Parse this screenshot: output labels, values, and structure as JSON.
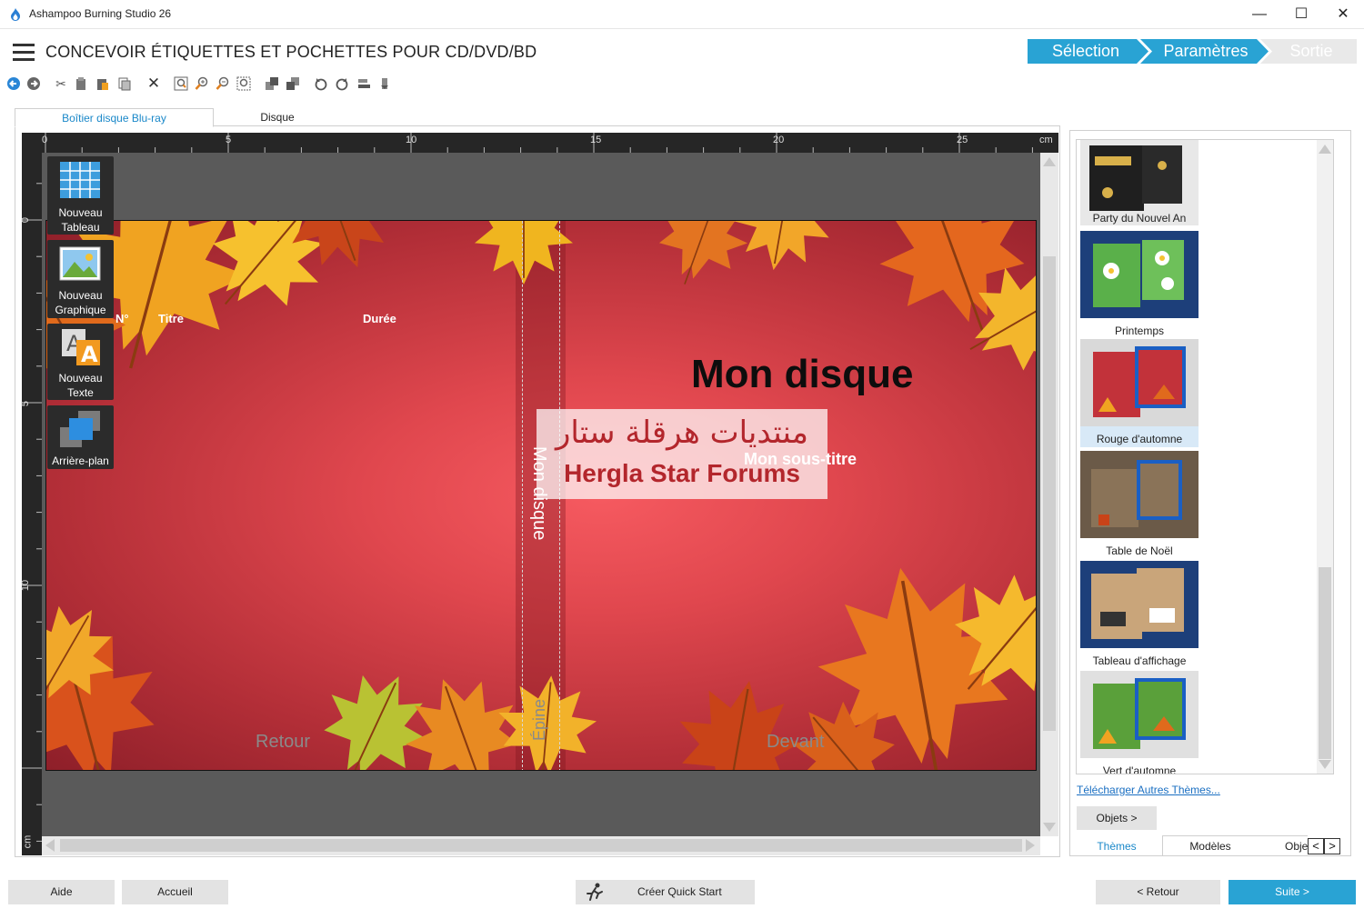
{
  "window": {
    "title": "Ashampoo Burning Studio 26",
    "minimize": "—",
    "maximize": "☐",
    "close": "✕"
  },
  "header": {
    "title": "CONCEVOIR ÉTIQUETTES ET POCHETTES POUR CD/DVD/BD",
    "steps": [
      {
        "label": "Sélection",
        "state": "active"
      },
      {
        "label": "Paramètres",
        "state": "active"
      },
      {
        "label": "Sortie",
        "state": "inactive"
      }
    ]
  },
  "toolbar": {
    "icons": [
      "back-icon",
      "forward-icon",
      "cut-icon",
      "copy-icon",
      "paste-icon",
      "duplicate-icon",
      "delete-icon",
      "zoom-fit-icon",
      "zoom-in-icon",
      "zoom-out-icon",
      "zoom-page-icon",
      "bring-front-icon",
      "send-back-icon",
      "rotate-left-icon",
      "rotate-right-icon",
      "align-left-icon",
      "align-right-icon"
    ]
  },
  "tabs": {
    "bluray": "Boîtier disque Blu-ray",
    "disc": "Disque"
  },
  "ruler": {
    "top_ticks": [
      "0",
      "5",
      "10",
      "15",
      "20",
      "25"
    ],
    "left_ticks": [
      "0",
      "5",
      "10"
    ],
    "unit": "cm"
  },
  "palette": [
    {
      "label1": "Nouveau",
      "label2": "Tableau",
      "icon": "table-icon"
    },
    {
      "label1": "Nouveau",
      "label2": "Graphique",
      "icon": "image-icon"
    },
    {
      "label1": "Nouveau",
      "label2": "Texte",
      "icon": "text-icon"
    },
    {
      "label1": "Arrière-plan",
      "label2": "",
      "icon": "background-icon"
    }
  ],
  "cover": {
    "title": "Mon disque",
    "subtitle": "Mon sous-titre",
    "spine_text": "Mon disque",
    "spine_label": "Épine",
    "back_label": "Retour",
    "front_label": "Devant",
    "columns": {
      "num": "N°",
      "title": "Titre",
      "duration": "Durée"
    }
  },
  "watermark": {
    "arabic": "منتديات هرقلة ستار",
    "latin": "Hergla Star Forums"
  },
  "themes": [
    {
      "name": "Party du Nouvel An",
      "selected": false
    },
    {
      "name": "Printemps",
      "selected": false
    },
    {
      "name": "Rouge d'automne",
      "selected": true
    },
    {
      "name": "Table de Noël",
      "selected": false
    },
    {
      "name": "Tableau d'affichage",
      "selected": false
    },
    {
      "name": "Vert d'automne",
      "selected": false
    }
  ],
  "right_panel": {
    "download_link": "Télécharger Autres Thèmes...",
    "objects_button": "Objets >",
    "tabs": {
      "themes": "Thèmes",
      "models": "Modèles",
      "objects": "Objets"
    },
    "prev": "<",
    "next": ">"
  },
  "footer": {
    "help": "Aide",
    "home": "Accueil",
    "quickstart": "Créer Quick Start",
    "back": "< Retour",
    "next": "Suite >"
  },
  "colors": {
    "accent": "#29a3d4",
    "cover_red": "#e0474e",
    "tab_blue": "#1a88c9"
  }
}
